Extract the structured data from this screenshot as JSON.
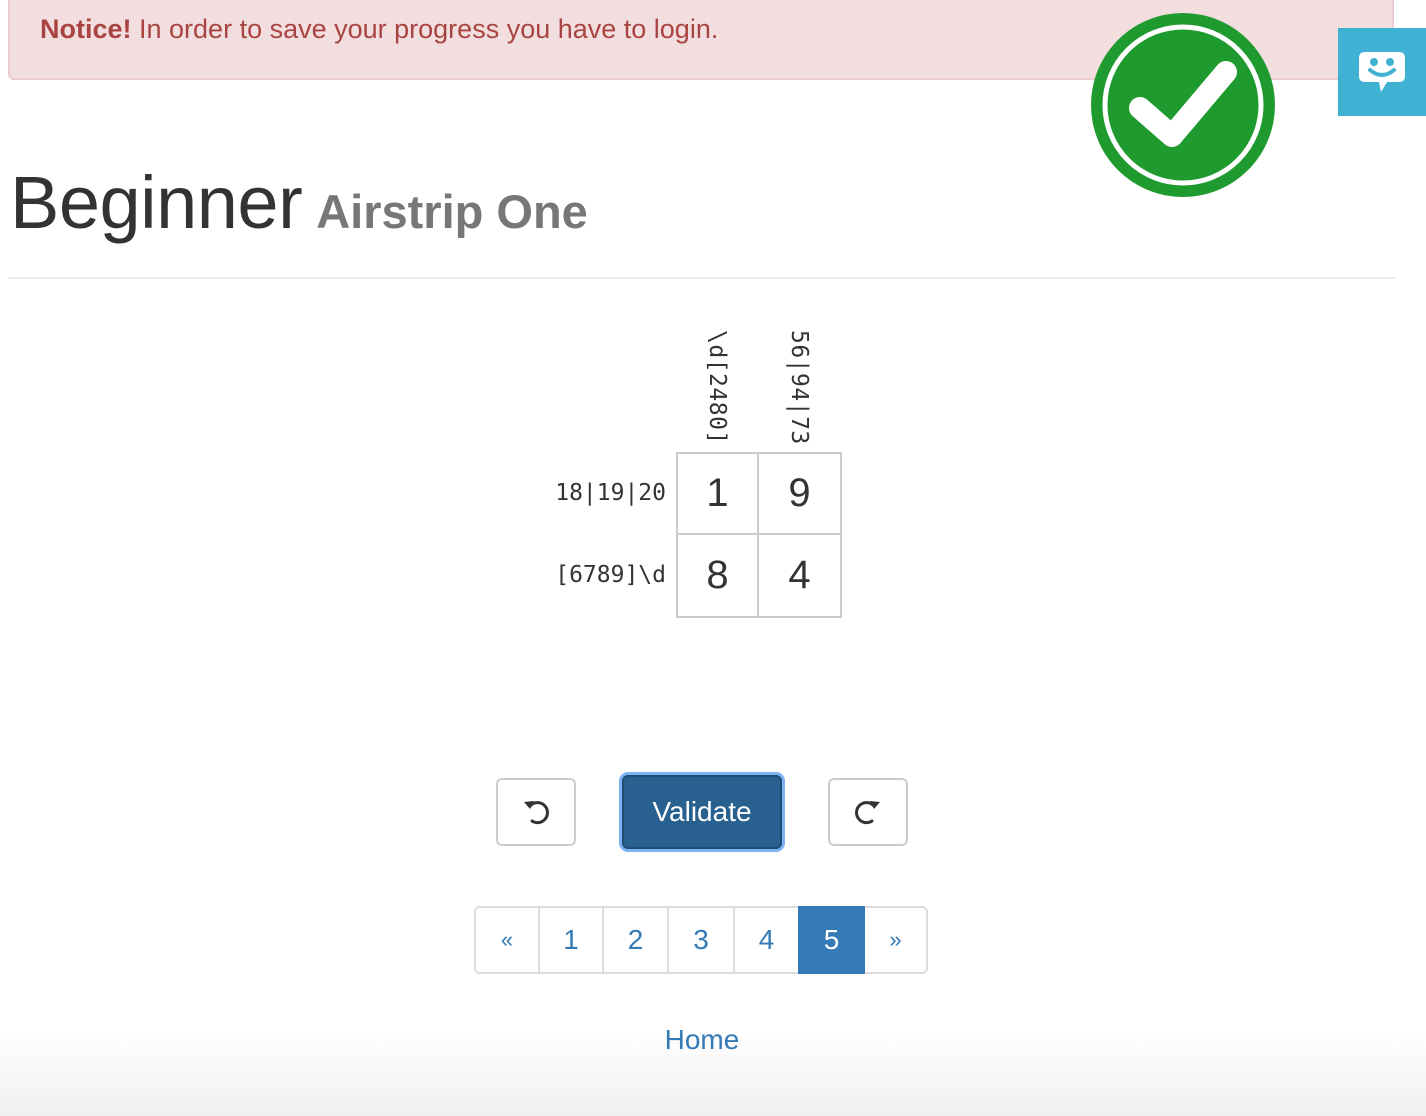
{
  "notice": {
    "label": "Notice!",
    "message": " In order to save your progress you have to login."
  },
  "feedback": {
    "icon": "smiley-chat-icon",
    "color": "#3fb1d3"
  },
  "status": {
    "icon": "success-checkmark-icon",
    "color": "#1f9a2e"
  },
  "header": {
    "title": "Beginner",
    "subtitle": "Airstrip One"
  },
  "puzzle": {
    "column_clues": [
      "\\d[2480]",
      "56|94|73"
    ],
    "row_clues": [
      "18|19|20",
      "[6789]\\d"
    ],
    "cells": [
      [
        "1",
        "9"
      ],
      [
        "8",
        "4"
      ]
    ]
  },
  "actions": {
    "undo_icon": "undo-icon",
    "validate_label": "Validate",
    "redo_icon": "redo-icon"
  },
  "pagination": {
    "prev": "«",
    "pages": [
      "1",
      "2",
      "3",
      "4",
      "5"
    ],
    "active_page": "5",
    "next": "»"
  },
  "footer": {
    "home_label": "Home"
  }
}
